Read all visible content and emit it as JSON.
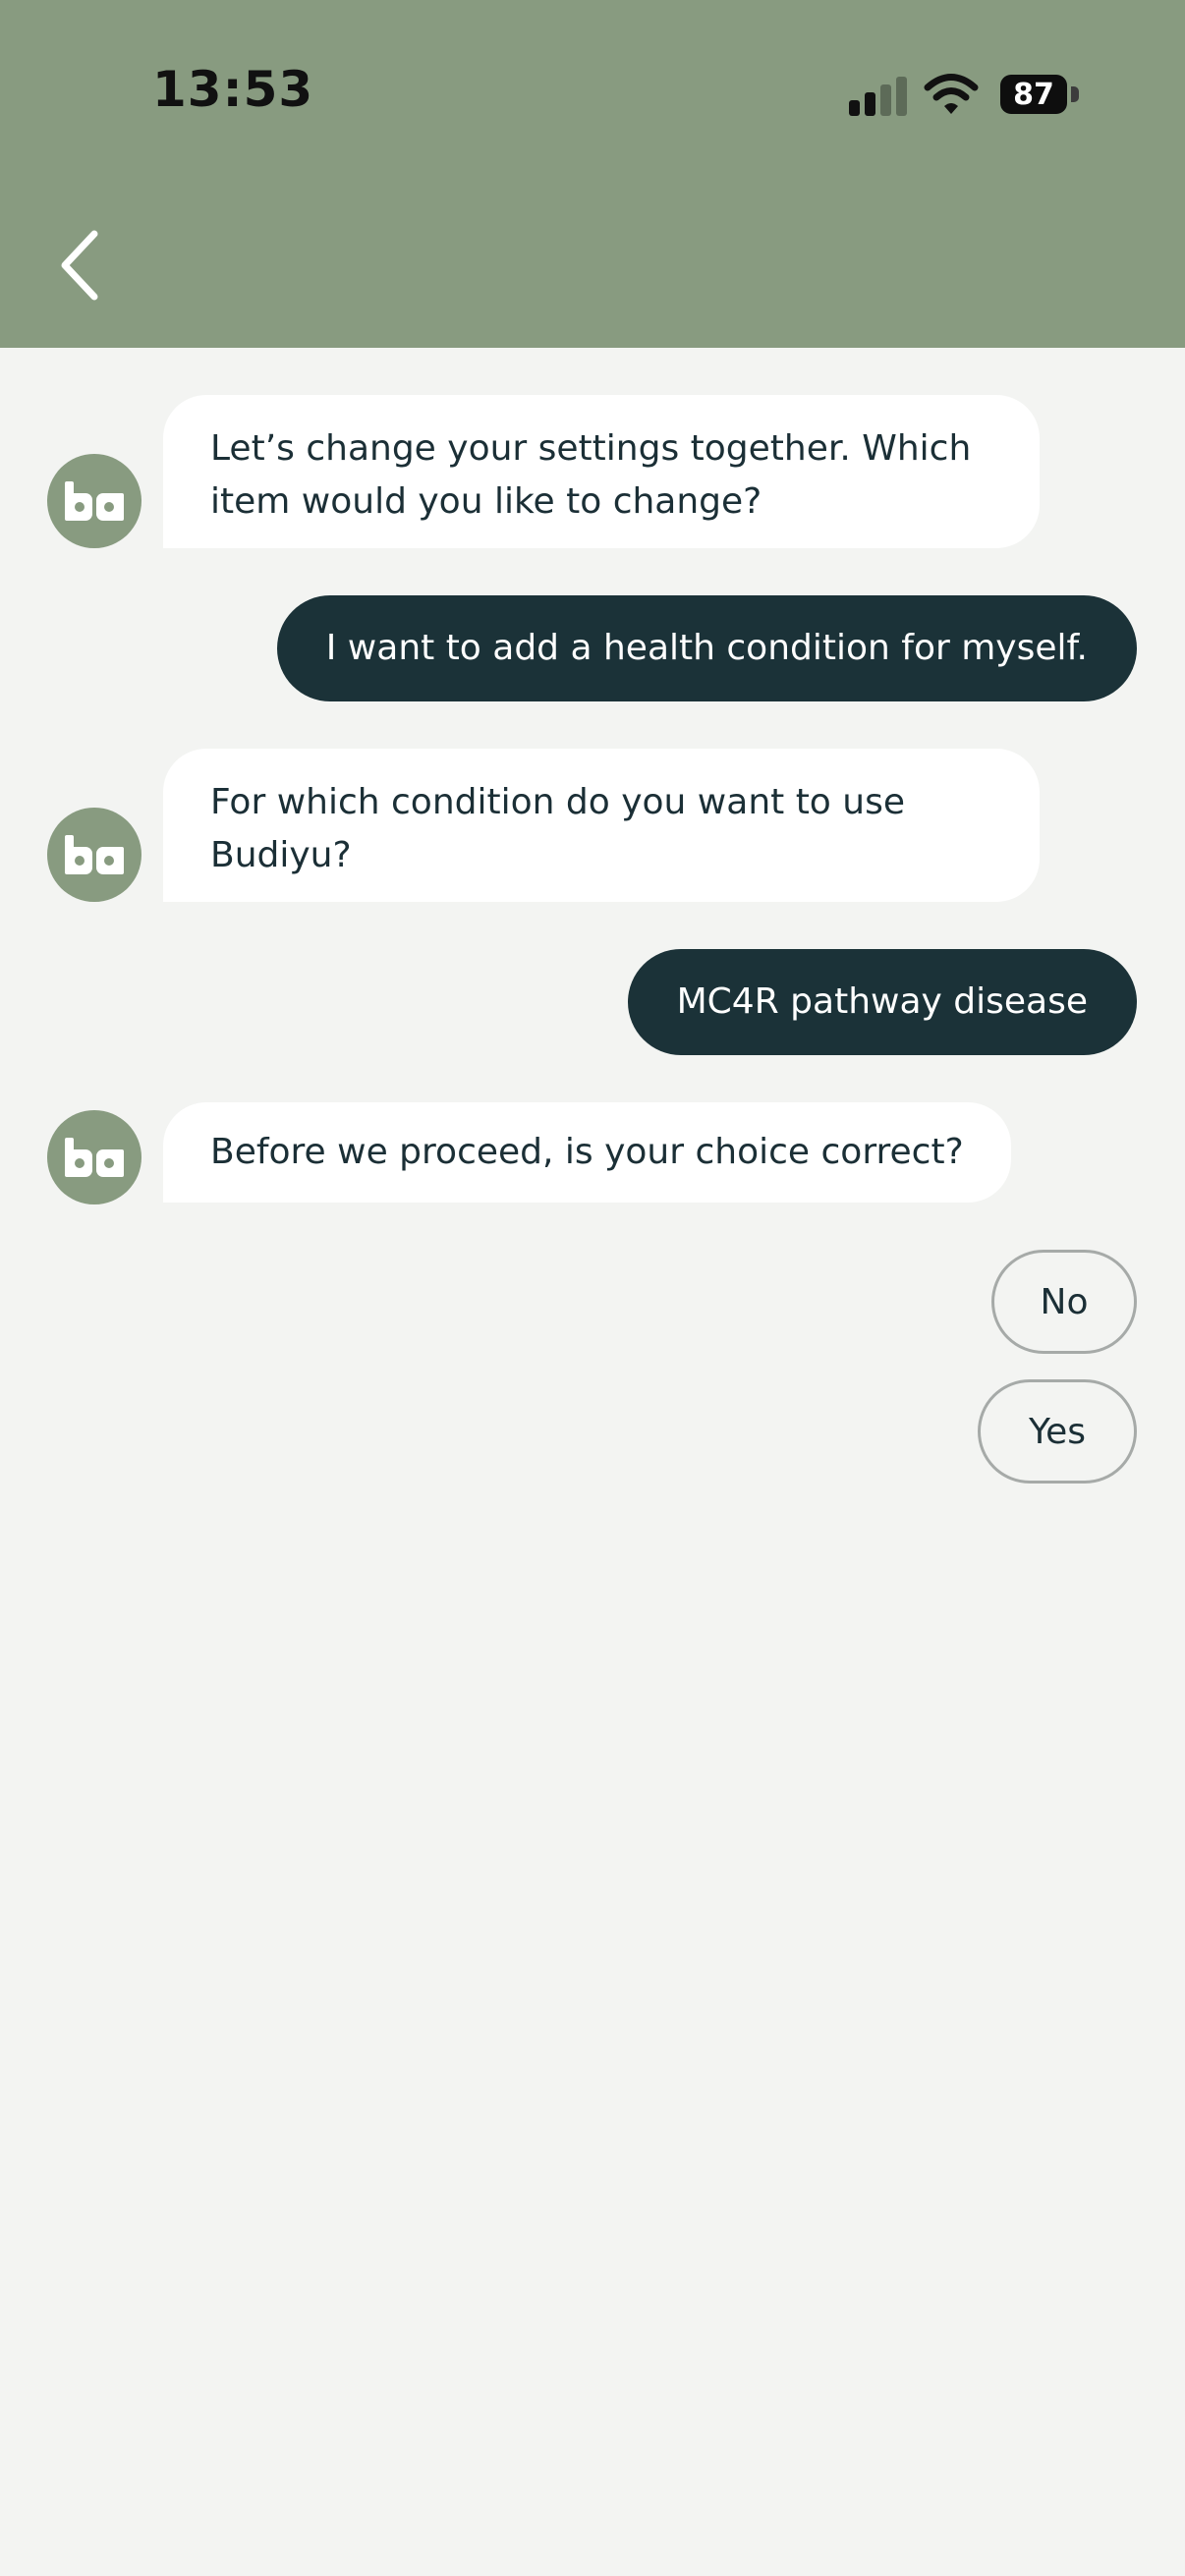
{
  "status_bar": {
    "time": "13:53",
    "battery": "87",
    "icons": [
      "cellular-signal-icon",
      "wifi-icon",
      "battery-icon"
    ]
  },
  "header": {
    "back_icon": "chevron-left-icon",
    "background_color": "#889b80"
  },
  "messages": [
    {
      "from": "bot",
      "text": "Let’s change your settings together. Which item would you like to change?"
    },
    {
      "from": "user",
      "text": "I want to add a health condition for myself."
    },
    {
      "from": "bot",
      "text": "For which condition do you want to use Budiyu?"
    },
    {
      "from": "user",
      "text": "MC4R pathway disease"
    },
    {
      "from": "bot",
      "text": "Before we proceed, is your choice correct?"
    }
  ],
  "quick_replies": [
    "No",
    "Yes"
  ],
  "colors": {
    "bot_bubble": "#ffffff",
    "user_bubble": "#1b3238",
    "page_background": "#f3f4f2",
    "avatar": "#889b80"
  }
}
